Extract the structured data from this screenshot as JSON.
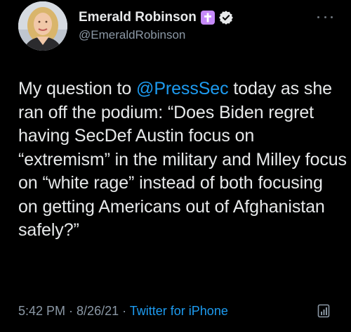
{
  "user": {
    "display_name": "Emerald Robinson",
    "handle": "@EmeraldRobinson",
    "badge_icon": "cross-badge-icon",
    "verified_icon": "verified-badge-icon"
  },
  "tweet": {
    "text_before": "My question to ",
    "mention": "@PressSec",
    "text_after": " today as she ran off the podium: “Does Biden regret having SecDef Austin focus on “extremism” in the military and Milley focus on “white rage” instead of both focusing on getting Americans out of Afghanistan safely?”",
    "time": "5:42 PM",
    "separator1": " · ",
    "date": "8/26/21",
    "separator2": " · ",
    "source": "Twitter for iPhone"
  },
  "colors": {
    "background": "#000000",
    "text": "#e7e9ea",
    "secondary": "#8b98a5",
    "link": "#1d9bf0",
    "badge": "#c58af9"
  },
  "icons": [
    "more-icon",
    "analytics-icon"
  ]
}
